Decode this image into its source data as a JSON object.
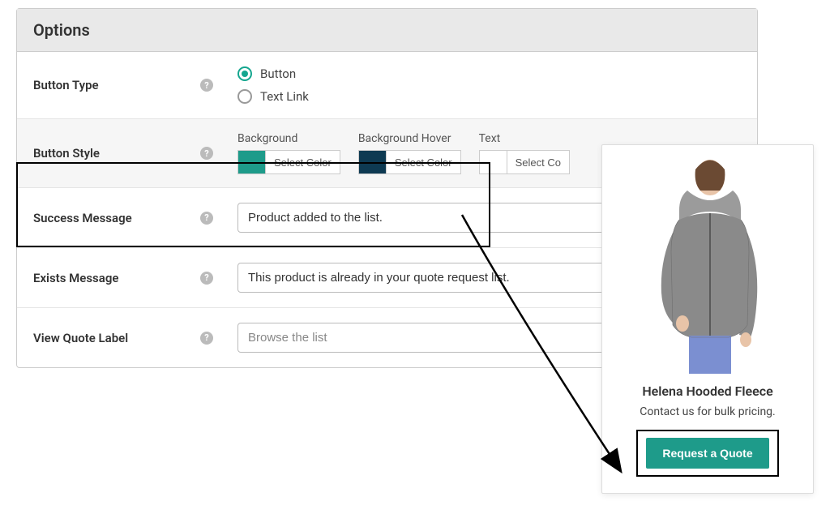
{
  "panel": {
    "title": "Options",
    "rows": {
      "button_type": {
        "label": "Button Type",
        "options": [
          "Button",
          "Text Link"
        ],
        "selected": "Button"
      },
      "button_style": {
        "label": "Button Style",
        "cols": {
          "background": {
            "label": "Background",
            "btn": "Select Color",
            "hex": "#1e9b8a"
          },
          "background_hover": {
            "label": "Background Hover",
            "btn": "Select Color",
            "hex": "#0e3a52"
          },
          "text": {
            "label": "Text",
            "btn": "Select Co",
            "hex": "#ffffff"
          }
        }
      },
      "success_message": {
        "label": "Success Message",
        "value": "Product added to the list."
      },
      "exists_message": {
        "label": "Exists Message",
        "value": "This product is already in your quote request list."
      },
      "view_quote_label": {
        "label": "View Quote Label",
        "placeholder": "Browse the list"
      }
    }
  },
  "preview": {
    "product_title": "Helena Hooded Fleece",
    "product_sub": "Contact us for bulk pricing.",
    "button_label": "Request a Quote"
  }
}
